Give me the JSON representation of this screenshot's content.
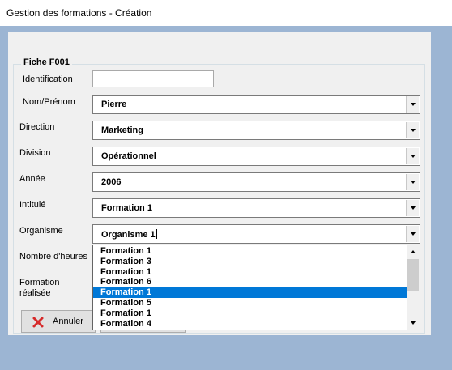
{
  "window": {
    "title": "Gestion des formations - Création"
  },
  "form": {
    "group_label": "Fiche F001",
    "fields": {
      "identification": {
        "label": "Identification",
        "value": ""
      },
      "nom_prenom": {
        "label": "Nom/Prénom",
        "value": "Pierre"
      },
      "direction": {
        "label": "Direction",
        "value": "Marketing"
      },
      "division": {
        "label": "Division",
        "value": "Opérationnel"
      },
      "annee": {
        "label": "Année",
        "value": "2006"
      },
      "intitule": {
        "label": "Intitulé",
        "value": "Formation 1"
      },
      "organisme": {
        "label": "Organisme",
        "value": "Organisme 1"
      },
      "nombre_heures": {
        "label": "Nombre d'heures"
      },
      "formation_realisee": {
        "label_line1": "Formation",
        "label_line2": "réalisée"
      }
    },
    "buttons": {
      "annuler": "Annuler"
    }
  },
  "dropdown": {
    "items": [
      {
        "label": "Formation 1",
        "selected": false
      },
      {
        "label": "Formation 3",
        "selected": false
      },
      {
        "label": "Formation 1",
        "selected": false
      },
      {
        "label": "Formation 6",
        "selected": false
      },
      {
        "label": "Formation 1",
        "selected": true
      },
      {
        "label": "Formation 5",
        "selected": false
      },
      {
        "label": "Formation 1",
        "selected": false
      },
      {
        "label": "Formation 4",
        "selected": false
      }
    ]
  },
  "icons": {
    "annuler": "red-x-icon",
    "combo_arrow": "chevron-down-icon",
    "scroll_up": "scroll-up-icon",
    "scroll_down": "scroll-down-icon"
  },
  "colors": {
    "background": "#9cb5d3",
    "form": "#f0f0f0",
    "selection": "#0078d7",
    "cancel_icon": "#d62a2a"
  }
}
